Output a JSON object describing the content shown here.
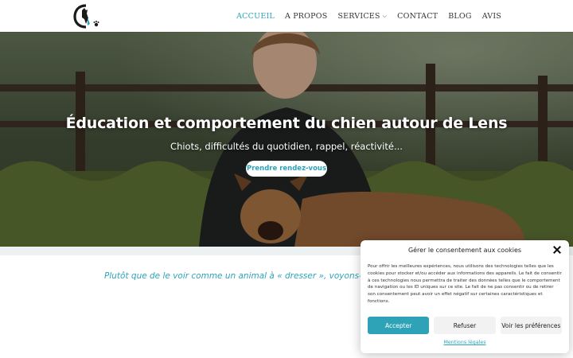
{
  "nav": {
    "items": [
      {
        "label": "ACCUEIL"
      },
      {
        "label": "A PROPOS"
      },
      {
        "label": "SERVICES"
      },
      {
        "label": "CONTACT"
      },
      {
        "label": "BLOG"
      },
      {
        "label": "AVIS"
      }
    ]
  },
  "hero": {
    "title": "Éducation et comportement du chien autour de Lens",
    "subtitle": "Chiots, difficultés du quotidien, rappel, réactivité...",
    "cta": "Prendre rendez-vous"
  },
  "intro": {
    "text": "Plutôt que de le voir comme un animal à « dresser », voyons-le comme"
  },
  "cookie": {
    "title": "Gérer le consentement aux cookies",
    "text": "Pour offrir les meilleures expériences, nous utilisons des technologies telles que les cookies pour stocker et/ou accéder aux informations des appareils. Le fait de consentir à ces technologies nous permettra de traiter des données telles que le comportement de navigation ou les ID uniques sur ce site. Le fait de ne pas consentir ou de retirer son consentement peut avoir un effet négatif sur certaines caractéristiques et fonctions.",
    "accept": "Accepter",
    "refuse": "Refuser",
    "preferences": "Voir les préférences",
    "link": "Mentions légales"
  },
  "colors": {
    "accent": "#2ea3b8",
    "text": "#333333"
  }
}
